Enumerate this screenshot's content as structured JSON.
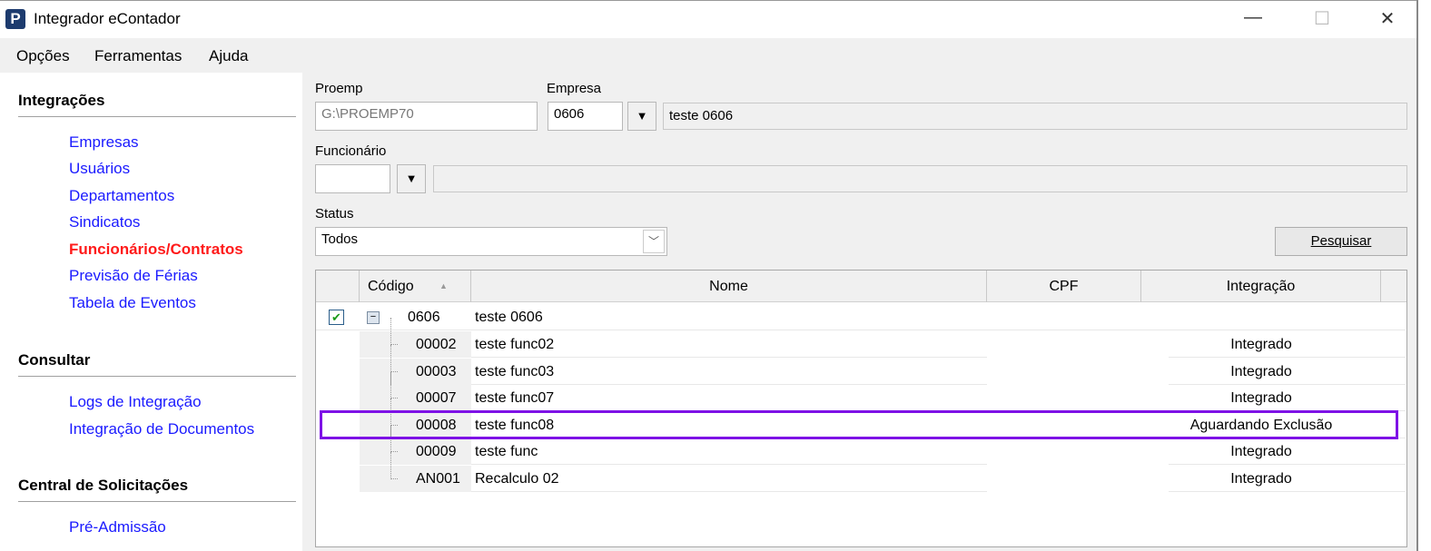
{
  "window": {
    "title": "Integrador eContador",
    "logo": "P",
    "minimize": "—",
    "maximize": "☐",
    "close": "✕"
  },
  "menu": [
    "Opções",
    "Ferramentas",
    "Ajuda"
  ],
  "sidebar": {
    "sections": [
      {
        "title": "Integrações",
        "items": [
          {
            "label": "Empresas"
          },
          {
            "label": "Usuários"
          },
          {
            "label": "Departamentos"
          },
          {
            "label": "Sindicatos"
          },
          {
            "label": "Funcionários/Contratos",
            "active": true
          },
          {
            "label": "Previsão de Férias"
          },
          {
            "label": "Tabela de Eventos"
          }
        ]
      },
      {
        "title": "Consultar",
        "items": [
          {
            "label": "Logs de Integração"
          },
          {
            "label": "Integração de Documentos"
          }
        ]
      },
      {
        "title": "Central de Solicitações",
        "items": [
          {
            "label": "Pré-Admissão"
          }
        ]
      }
    ]
  },
  "form": {
    "proemp_label": "Proemp",
    "proemp_value": "G:\\PROEMP70",
    "empresa_label": "Empresa",
    "empresa_code": "0606",
    "empresa_name": "teste 0606",
    "funcionario_label": "Funcionário",
    "funcionario_code": "",
    "funcionario_name": "",
    "status_label": "Status",
    "status_value": "Todos",
    "search_button": "Pesquisar"
  },
  "grid": {
    "columns": [
      "Código",
      "Nome",
      "CPF",
      "Integração"
    ],
    "sort_indicator": "▲",
    "parent": {
      "checked": true,
      "code": "0606",
      "name": "teste 0606",
      "cpf": "",
      "integracao": ""
    },
    "rows": [
      {
        "code": "00002",
        "name": "teste func02",
        "cpf": "",
        "integracao": "Integrado"
      },
      {
        "code": "00003",
        "name": "teste func03",
        "cpf": "",
        "integracao": "Integrado"
      },
      {
        "code": "00007",
        "name": "teste func07",
        "cpf": "",
        "integracao": "Integrado"
      },
      {
        "code": "00008",
        "name": "teste func08",
        "cpf": "",
        "integracao": "Aguardando Exclusão",
        "highlighted": true
      },
      {
        "code": "00009",
        "name": "teste func",
        "cpf": "",
        "integracao": "Integrado"
      },
      {
        "code": "AN001",
        "name": "Recalculo 02",
        "cpf": "",
        "integracao": "Integrado"
      }
    ]
  },
  "colors": {
    "highlight": "#7e12e6",
    "link": "#1a1aff",
    "active_link": "#ff1a1a"
  }
}
